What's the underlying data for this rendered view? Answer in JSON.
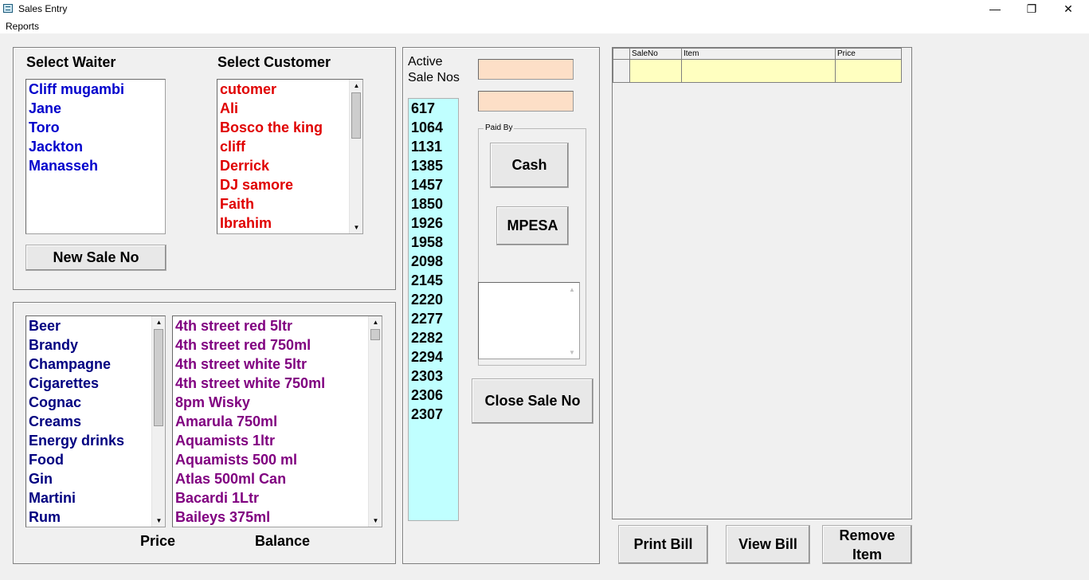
{
  "window": {
    "title": "Sales Entry",
    "minimize": "—",
    "restore": "❐",
    "close": "✕"
  },
  "menu": {
    "reports": "Reports"
  },
  "waiter": {
    "label": "Select Waiter",
    "items": [
      "Cliff  mugambi",
      "Jane",
      "Toro",
      "Jackton",
      "Manasseh"
    ],
    "color": "#0000cc"
  },
  "customer": {
    "label": "Select Customer",
    "items": [
      " cutomer",
      "Ali",
      "Bosco the king",
      "cliff",
      "Derrick",
      "DJ samore",
      "Faith",
      "Ibrahim"
    ],
    "color": "#e00000"
  },
  "new_sale_button": "New Sale No",
  "categories": {
    "items": [
      "Beer",
      "Brandy",
      "Champagne",
      "Cigarettes",
      "Cognac",
      "Creams",
      "Energy drinks",
      "Food",
      "Gin",
      "Martini",
      "Rum"
    ],
    "color": "#000080"
  },
  "products": {
    "items": [
      "4th street red 5ltr",
      "4th street red 750ml",
      "4th street white 5ltr",
      "4th street white 750ml",
      "8pm Wisky",
      "Amarula 750ml",
      "Aquamists 1ltr",
      "Aquamists 500 ml",
      "Atlas 500ml Can",
      "Bacardi 1Ltr",
      "Baileys 375ml"
    ],
    "color": "#800080"
  },
  "price_label": "Price",
  "balance_label": "Balance",
  "active_sales": {
    "label_line1": "Active",
    "label_line2": "Sale Nos",
    "items": [
      "617",
      "1064",
      "1131",
      "1385",
      "1457",
      "1850",
      "1926",
      "1958",
      "2098",
      "2145",
      "2220",
      "2277",
      "2282",
      "2294",
      "2303",
      "2306",
      "2307"
    ],
    "bg": "#c0ffff"
  },
  "paid_by": {
    "label": "Paid By",
    "cash": "Cash",
    "mpesa": "MPESA"
  },
  "close_sale_button": "Close Sale No",
  "grid": {
    "columns": [
      "SaleNo",
      "Item",
      "Price"
    ],
    "row_bg": "#ffffc0"
  },
  "print_bill_button": "Print Bill",
  "view_bill_button": "View Bill",
  "remove_item_line1": "Remove",
  "remove_item_line2": "Item"
}
